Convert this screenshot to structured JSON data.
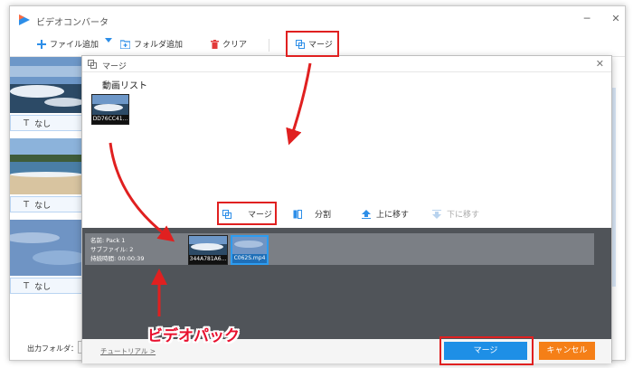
{
  "window": {
    "title": "ビデオコンバータ",
    "minimize": "─",
    "close": "✕"
  },
  "toolbar": {
    "add_file": "ファイル追加",
    "add_folder": "フォルダ追加",
    "clear": "クリア",
    "merge": "マージ"
  },
  "file_list": {
    "subtitle_label": "なし",
    "t_glyph": "T"
  },
  "bottom": {
    "output_folder_label": "出力フォルダ："
  },
  "dialog": {
    "title": "マージ",
    "close": "✕",
    "list_title": "動画リスト",
    "list_items": [
      {
        "caption": "DD76CC41..."
      }
    ],
    "actions": {
      "merge": "マージ",
      "split": "分割",
      "move_up": "上に移す",
      "move_down": "下に移す"
    },
    "pack": {
      "name_line": "名前: Pack 1",
      "sub_files_line": "サブファイル: 2",
      "duration_line": "持続時間: 00:00:39",
      "items": [
        {
          "caption": "344A781A6..."
        },
        {
          "caption": "C062S.mp4"
        }
      ]
    },
    "footer": {
      "tutorial": "チュートリアル >",
      "merge_button": "マージ",
      "cancel_button": "キャンセル"
    }
  },
  "annotation": {
    "label": "ビデオパック"
  },
  "colors": {
    "accent_blue": "#1e8fe6",
    "cancel_orange": "#f57f17",
    "annotation_red": "#e02020",
    "pack_area_bg": "#505459"
  }
}
